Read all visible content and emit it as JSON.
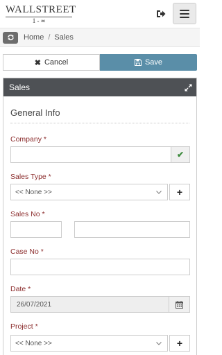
{
  "brand": {
    "name": "WALLSTREET",
    "tagline": "1 - ∞"
  },
  "breadcrumb": {
    "home": "Home",
    "separator": "/",
    "current": "Sales"
  },
  "actions": {
    "cancel_label": "Cancel",
    "save_label": "Save"
  },
  "panel": {
    "title": "Sales",
    "section_title": "General Info"
  },
  "form": {
    "company": {
      "label": "Company *",
      "value": ""
    },
    "sales_type": {
      "label": "Sales Type *",
      "value": "<< None >>"
    },
    "sales_no": {
      "label": "Sales No *",
      "prefix": "",
      "value": ""
    },
    "case_no": {
      "label": "Case No *",
      "value": ""
    },
    "date": {
      "label": "Date *",
      "value": "26/07/2021"
    },
    "project": {
      "label": "Project *",
      "value": "<< None >>"
    }
  },
  "colors": {
    "header_bar": "#4e5155",
    "save_button": "#5a8ea8",
    "required_label": "#8b2c2c",
    "check": "#3c8a3c"
  }
}
